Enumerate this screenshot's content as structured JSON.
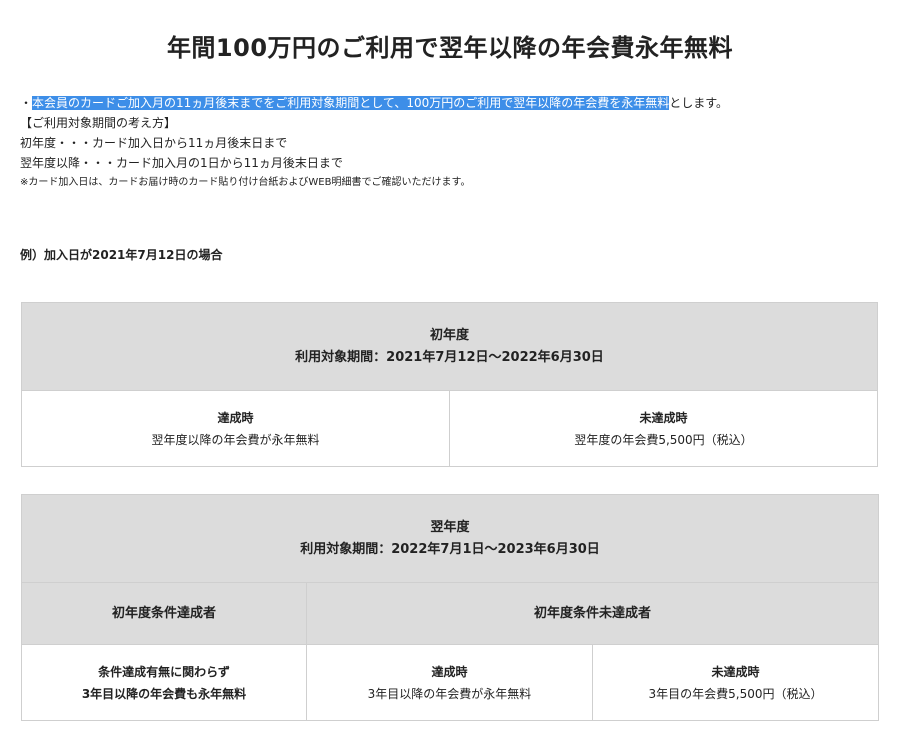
{
  "title": "年間100万円のご利用で翌年以降の年会費永年無料",
  "notes": {
    "bullet": "・",
    "highlighted": "本会員のカードご加入月の11ヵ月後末までをご利用対象期間として、100万円のご利用で翌年以降の年会費を永年無料",
    "tail": "とします。",
    "concept_header": "【ご利用対象期間の考え方】",
    "first_year": "初年度・・・カード加入日から11ヵ月後末日まで",
    "next_years": "翌年度以降・・・カード加入月の1日から11ヵ月後末日まで",
    "footnote": "※カード加入日は、カードお届け時のカード貼り付け台紙およびWEB明細書でご確認いただけます。"
  },
  "example": "例）加入日が2021年7月12日の場合",
  "table1": {
    "year": "初年度",
    "period": "利用対象期間：2021年7月12日〜2022年6月30日",
    "achieved_title": "達成時",
    "achieved_text": "翌年度以降の年会費が永年無料",
    "not_achieved_title": "未達成時",
    "not_achieved_text": "翌年度の年会費5,500円（税込）"
  },
  "table2": {
    "year": "翌年度",
    "period": "利用対象期間：2022年7月1日〜2023年6月30日",
    "col_a": "初年度条件達成者",
    "col_b": "初年度条件未達成者",
    "a_line1": "条件達成有無に関わらず",
    "a_line2": "3年目以降の年会費も永年無料",
    "achieved_title": "達成時",
    "achieved_text": "3年目以降の年会費が永年無料",
    "not_achieved_title": "未達成時",
    "not_achieved_text": "3年目の年会費5,500円（税込）"
  },
  "colors": {
    "highlight": "#3d8ee8",
    "header_bg": "#dcdcdc",
    "border": "#cfcfcf"
  }
}
